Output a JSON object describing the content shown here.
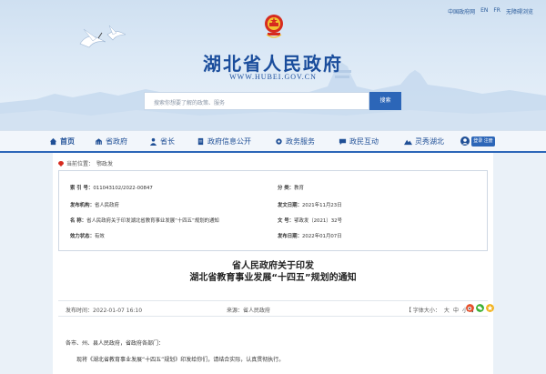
{
  "top_links": [
    "中国政府网",
    "EN",
    "FR",
    "无障碍浏览"
  ],
  "site": {
    "title": "湖北省人民政府",
    "url": "WWW.HUBEI.GOV.CN"
  },
  "search": {
    "placeholder": "搜索你想要了解的政策、服务",
    "button": "搜索"
  },
  "nav": {
    "items": [
      {
        "label": "首页",
        "icon": "home-icon"
      },
      {
        "label": "省政府",
        "icon": "building-icon"
      },
      {
        "label": "省长",
        "icon": "person-icon"
      },
      {
        "label": "政府信息公开",
        "icon": "document-icon"
      },
      {
        "label": "政务服务",
        "icon": "gear-icon"
      },
      {
        "label": "政民互动",
        "icon": "chat-icon"
      },
      {
        "label": "灵秀湖北",
        "icon": "mountain-icon"
      }
    ],
    "login": "登录 注册"
  },
  "breadcrumb": {
    "prefix": "当前位置：",
    "current": "鄂政发"
  },
  "meta": {
    "index_label": "索 引 号：",
    "index_value": "011043102/2022-00847",
    "category_label": "分       类：",
    "category_value": "教育",
    "issuer_label": "发布机构：",
    "issuer_value": "省人民政府",
    "issue_date_label": "发文日期：",
    "issue_date_value": "2021年11月23日",
    "name_label": "名       称：",
    "name_value": "省人民政府关于印发湖北省教育事业发展“十四五”规划的通知",
    "doc_no_label": "文       号：",
    "doc_no_value": "鄂政发〔2021〕32号",
    "status_label": "效力状态：",
    "status_value": "有效",
    "pub_date_label": "发布日期：",
    "pub_date_value": "2022年01月07日"
  },
  "document": {
    "title_line1": "省人民政府关于印发",
    "title_line2": "湖北省教育事业发展“十四五”规划的通知",
    "publish_time": "发布时间：2022-01-07 16:10",
    "source_label": "来源：",
    "source_value": "省人民政府",
    "font_size_label": "【 字体大小：",
    "font_size_options": [
      "大",
      "中",
      "小"
    ],
    "font_size_end": "】",
    "salutation": "各市、州、县人民政府，省政府各部门：",
    "paragraph": "现将《湖北省教育事业发展“十四五”规划》印发给你们，请结合实际，认真贯彻执行。"
  },
  "colors": {
    "brand_blue": "#1a4d9c",
    "nav_underline": "#2c66b8",
    "wechat": "#3cb034",
    "weibo": "#e6502b"
  }
}
